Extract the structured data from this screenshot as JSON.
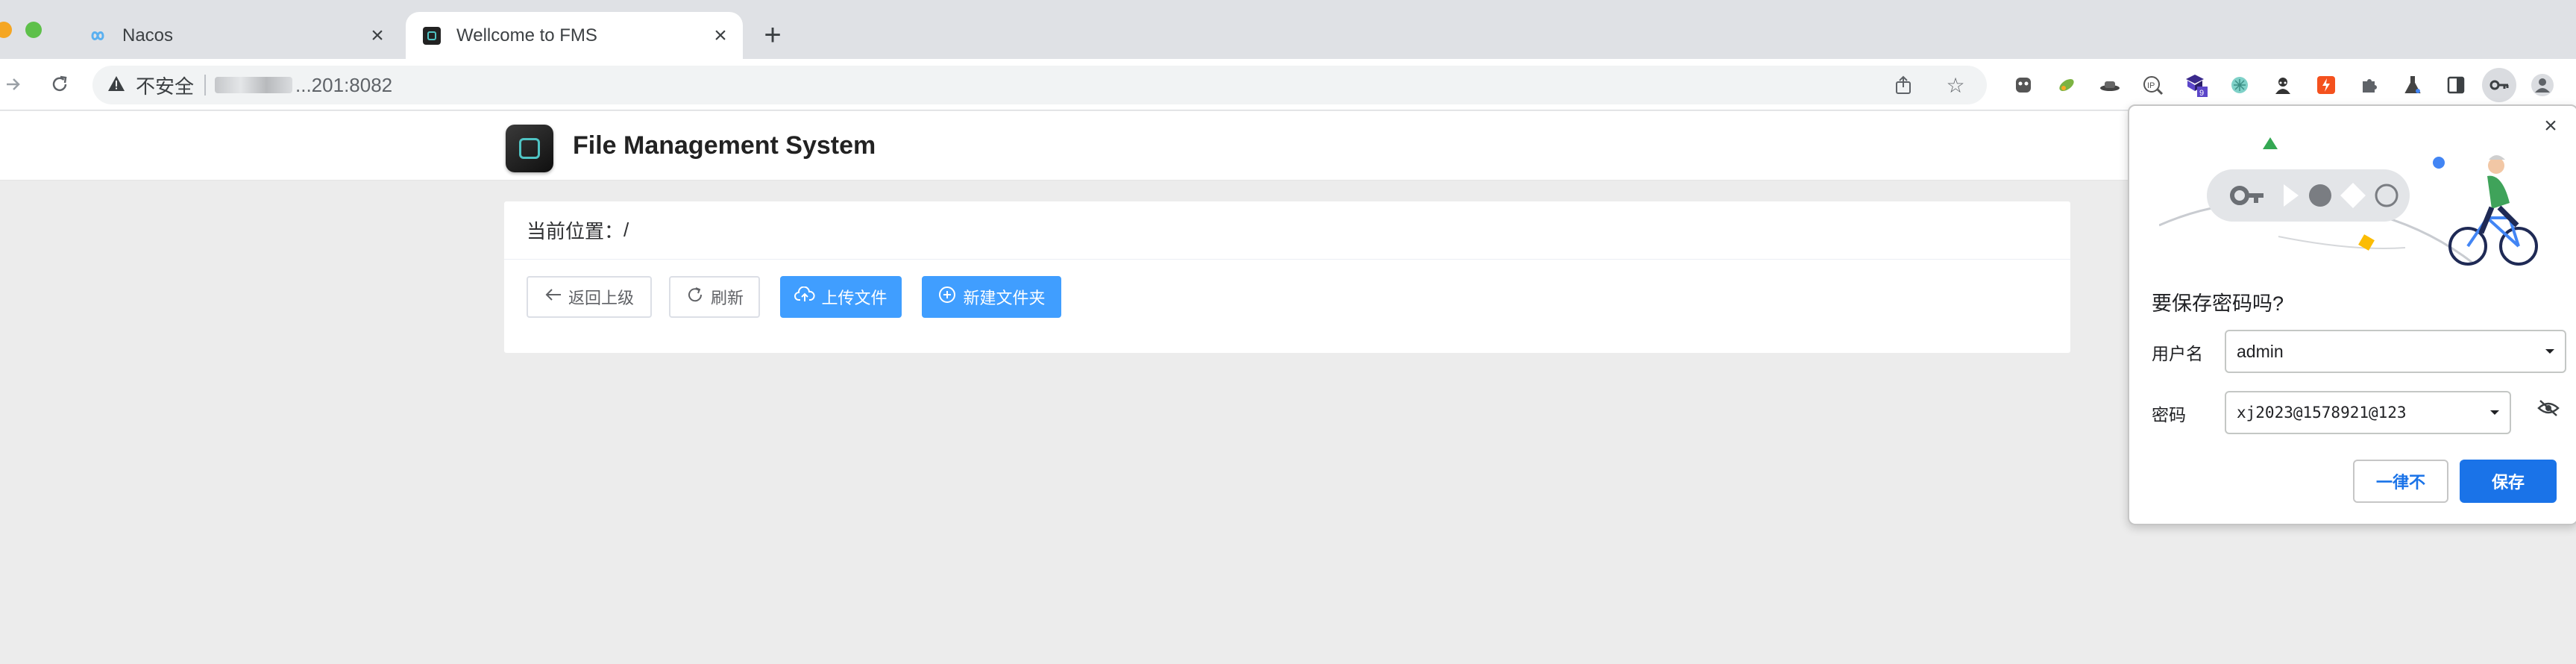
{
  "browser": {
    "tabs": [
      {
        "title": "Nacos",
        "active": false,
        "icon": "nacos-infinity-icon"
      },
      {
        "title": "Wellcome to FMS",
        "active": true,
        "icon": "fms-favicon"
      }
    ],
    "address": {
      "security_label": "不安全",
      "host_suffix": "...201:8082"
    },
    "extension_badge": "9"
  },
  "app": {
    "title": "File Management System"
  },
  "breadcrumb": {
    "label": "当前位置：",
    "path": "/"
  },
  "actions": {
    "back": "返回上级",
    "refresh": "刷新",
    "upload": "上传文件",
    "new_folder": "新建文件夹"
  },
  "password_dialog": {
    "title": "要保存密码吗?",
    "username_label": "用户名",
    "username_value": "admin",
    "password_label": "密码",
    "password_value": "xj2023@1578921@123",
    "never_button": "一律不",
    "save_button": "保存"
  },
  "colors": {
    "primary": "#409eff",
    "chrome_blue": "#1a73e8",
    "page_bg": "#ececec"
  }
}
